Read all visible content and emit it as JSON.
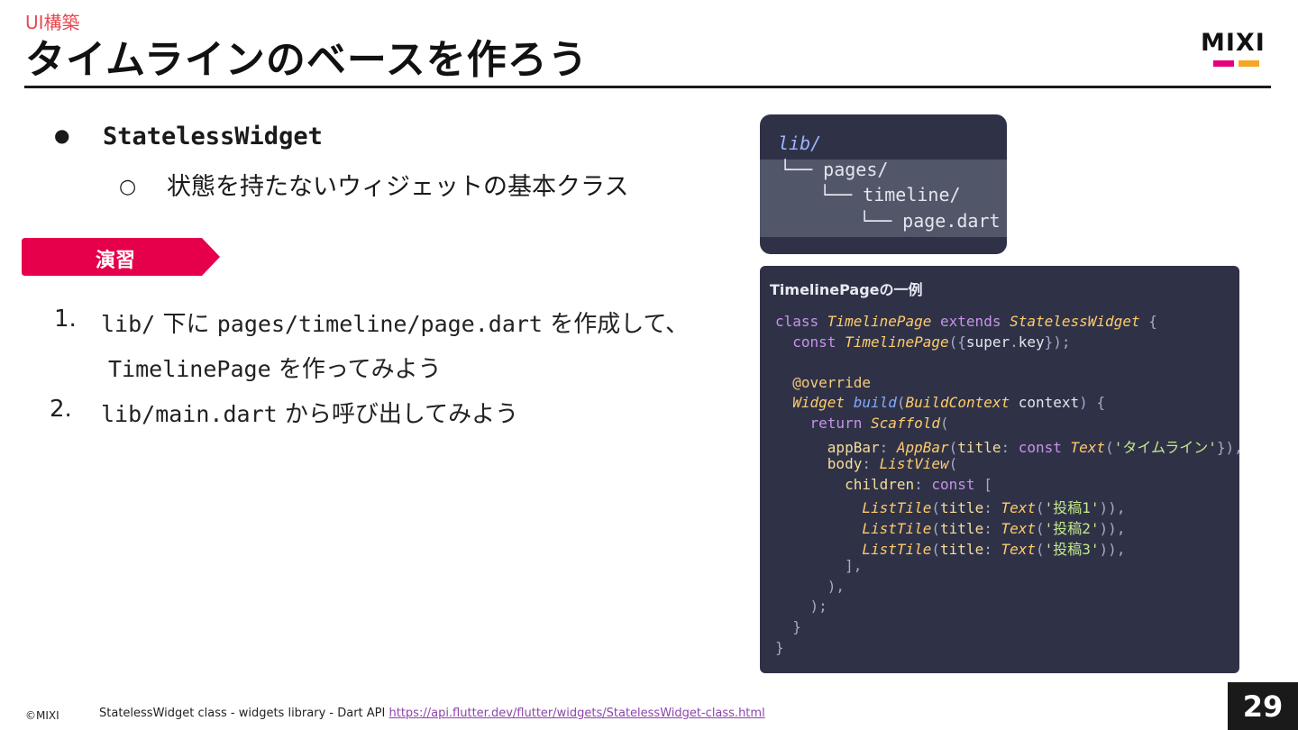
{
  "header": {
    "category": "UI構築",
    "title": "タイムラインのベースを作ろう",
    "logo_text": "MIXI",
    "logo_bar_colors": [
      "#e6007e",
      "#f5a623"
    ]
  },
  "bullets": {
    "main_marker": "●",
    "main_label": "StatelessWidget",
    "sub_marker": "○",
    "sub_label": "状態を持たないウィジェットの基本クラス"
  },
  "exercise": {
    "label": "演習",
    "color": "#e6004c"
  },
  "steps": [
    {
      "number": "1.",
      "line1": [
        {
          "code": "lib/"
        },
        {
          "text": " 下に "
        },
        {
          "code": "pages/timeline/page.dart"
        },
        {
          "text": " を作成して、"
        }
      ],
      "line2": [
        {
          "code": "TimelinePage"
        },
        {
          "text": " を作ってみよう"
        }
      ]
    },
    {
      "number": "2.",
      "line1": [
        {
          "code": "lib/main.dart"
        },
        {
          "text": " から呼び出してみよう"
        }
      ]
    }
  ],
  "file_tree": {
    "lines": [
      "lib/",
      "└── pages/",
      "└── timeline/",
      "└── page.dart"
    ]
  },
  "code_sample": {
    "caption": "TimelinePageの一例",
    "lines": [
      [
        [
          "kw",
          "class "
        ],
        [
          "cls",
          "TimelinePage"
        ],
        [
          "kw",
          " extends "
        ],
        [
          "cls",
          "StatelessWidget"
        ],
        [
          "pun",
          " {"
        ]
      ],
      [
        [
          "kw",
          "  const "
        ],
        [
          "cls",
          "TimelinePage"
        ],
        [
          "pun",
          "({"
        ],
        [
          "",
          "super"
        ],
        [
          "pun",
          "."
        ],
        [
          "",
          "key"
        ],
        [
          "pun",
          "});"
        ]
      ],
      [],
      [
        [
          "ann",
          "  @override"
        ]
      ],
      [
        [
          "cls",
          "  Widget "
        ],
        [
          "fn",
          "build"
        ],
        [
          "pun",
          "("
        ],
        [
          "cls",
          "BuildContext"
        ],
        [
          "",
          " context"
        ],
        [
          "pun",
          ") {"
        ]
      ],
      [
        [
          "kw",
          "    return "
        ],
        [
          "cls",
          "Scaffold"
        ],
        [
          "pun",
          "("
        ]
      ],
      [
        [
          "prop",
          "      appBar"
        ],
        [
          "pun",
          ": "
        ],
        [
          "cls",
          "AppBar"
        ],
        [
          "pun",
          "("
        ],
        [
          "prop",
          "title"
        ],
        [
          "pun",
          ": "
        ],
        [
          "kw",
          "const "
        ],
        [
          "cls",
          "Text"
        ],
        [
          "pun",
          "("
        ],
        [
          "str",
          "'タイムライン'"
        ],
        [
          "pun",
          "}),"
        ]
      ],
      [
        [
          "prop",
          "      body"
        ],
        [
          "pun",
          ": "
        ],
        [
          "cls",
          "ListView"
        ],
        [
          "pun",
          "("
        ]
      ],
      [
        [
          "prop",
          "        children"
        ],
        [
          "pun",
          ": "
        ],
        [
          "kw",
          "const "
        ],
        [
          "pun",
          "["
        ]
      ],
      [
        [
          "cls",
          "          ListTile"
        ],
        [
          "pun",
          "("
        ],
        [
          "prop",
          "title"
        ],
        [
          "pun",
          ": "
        ],
        [
          "cls",
          "Text"
        ],
        [
          "pun",
          "("
        ],
        [
          "str",
          "'投稿1'"
        ],
        [
          "pun",
          ")),"
        ]
      ],
      [
        [
          "cls",
          "          ListTile"
        ],
        [
          "pun",
          "("
        ],
        [
          "prop",
          "title"
        ],
        [
          "pun",
          ": "
        ],
        [
          "cls",
          "Text"
        ],
        [
          "pun",
          "("
        ],
        [
          "str",
          "'投稿2'"
        ],
        [
          "pun",
          ")),"
        ]
      ],
      [
        [
          "cls",
          "          ListTile"
        ],
        [
          "pun",
          "("
        ],
        [
          "prop",
          "title"
        ],
        [
          "pun",
          ": "
        ],
        [
          "cls",
          "Text"
        ],
        [
          "pun",
          "("
        ],
        [
          "str",
          "'投稿3'"
        ],
        [
          "pun",
          ")),"
        ]
      ],
      [
        [
          "pun",
          "        ],"
        ]
      ],
      [
        [
          "pun",
          "      ),"
        ]
      ],
      [
        [
          "pun",
          "    );"
        ]
      ],
      [
        [
          "pun",
          "  }"
        ]
      ],
      [
        [
          "pun",
          "}"
        ]
      ]
    ]
  },
  "footer": {
    "copyright": "©MIXI",
    "source_text": "StatelessWidget class - widgets library - Dart API",
    "source_link": "https://api.flutter.dev/flutter/widgets/StatelessWidget-class.html",
    "page_number": "29"
  }
}
